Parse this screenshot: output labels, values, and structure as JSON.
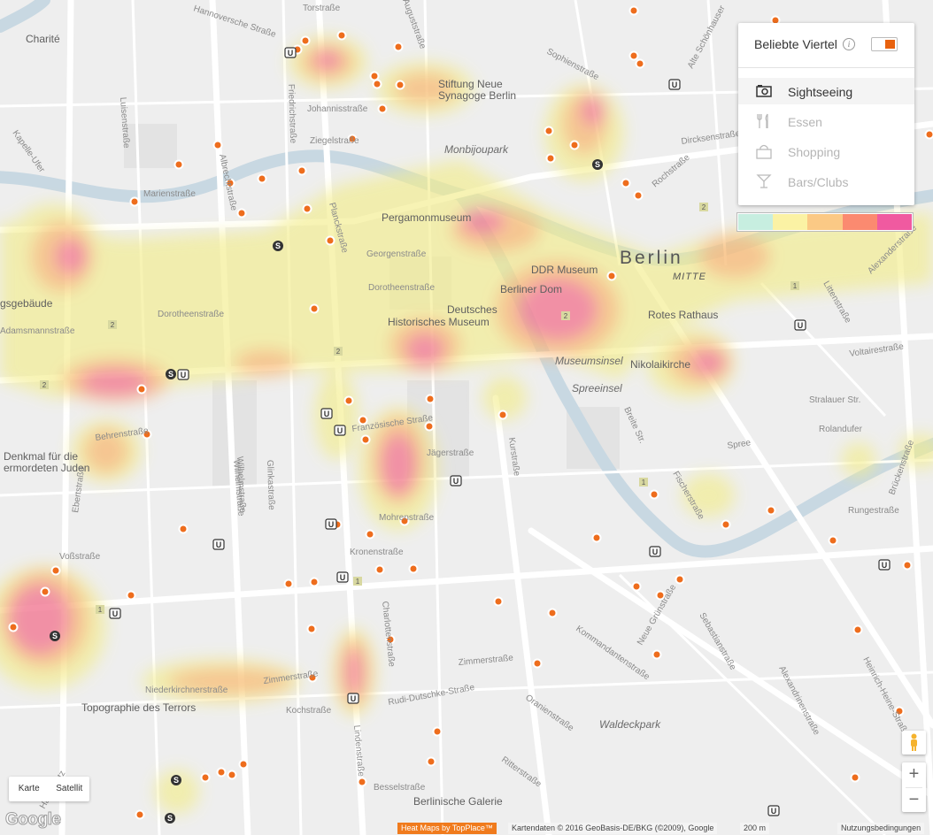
{
  "panel": {
    "title": "Beliebte Viertel",
    "info_glyph": "i",
    "toggle_on": true,
    "categories": [
      {
        "label": "Sightseeing",
        "icon": "camera-icon",
        "active": true
      },
      {
        "label": "Essen",
        "icon": "fork-knife-icon",
        "active": false
      },
      {
        "label": "Shopping",
        "icon": "shopping-bag-icon",
        "active": false
      },
      {
        "label": "Bars/Clubs",
        "icon": "cocktail-icon",
        "active": false
      }
    ]
  },
  "legend_colors": [
    "#c7eee0",
    "#fbf2a4",
    "#fbc985",
    "#fb8a70",
    "#f05aa0"
  ],
  "accent_color": "#e8620e",
  "map_labels": {
    "city": "Berlin",
    "district": "MITTE",
    "pois": [
      "Charité",
      "Pergamonmuseum",
      "DDR Museum",
      "Berliner Dom",
      "Deutsches",
      "Historisches Museum",
      "Rotes Rathaus",
      "Nikolaikirche",
      "Stiftung Neue",
      "Synagoge Berlin",
      "Topographie des Terrors",
      "Berlinische Galerie",
      "Denkmal für die",
      "ermordeten Juden",
      "gsgebäude"
    ],
    "parks": [
      "Monbijoupark",
      "Museumsinsel",
      "Spreeinsel",
      "Waldeckpark"
    ],
    "streets": [
      "Hannoversche Straße",
      "Torstraße",
      "Auguststraße",
      "Sophienstraße",
      "Alte Schönhauser",
      "Johannisstraße",
      "Ziegelstraße",
      "Dircksenstraße",
      "Rochstraße",
      "Marienstraße",
      "Albrechtstraße",
      "Luisenstraße",
      "Friedrichstraße",
      "Planckstraße",
      "Georgenstraße",
      "Dorotheenstraße",
      "Oranienburger Straße",
      "Reinhardtstraße",
      "Gipsstraße",
      "Behrenstraße",
      "Wilhelmstraße",
      "Französische Straße",
      "Jägerstraße",
      "Mohrenstraße",
      "Kronenstraße",
      "Mauerstraße",
      "Glinkastraße",
      "Voßstraße",
      "Ebertstraße",
      "Leipziger Straße",
      "Niederkirchnerstraße",
      "Zimmerstraße",
      "Kochstraße",
      "Rudi-Dutschke-Straße",
      "Lindenstraße",
      "Charlottenstraße",
      "Markgrafenstraße",
      "Besselstraße",
      "Ritterstraße",
      "Oranienstraße",
      "Kommandantenstraße",
      "Neue Grünstraße",
      "Sebastianstraße",
      "Alexandrinenstraße",
      "Heinrich-Heine-Straße",
      "Köpenicker Straße",
      "Brückenstraße",
      "Rungestraße",
      "Fischerstraße",
      "Breite Str.",
      "Kurstraße",
      "Spree",
      "Stralauer Str.",
      "Rolandufer",
      "Littenstraße",
      "Voltairestraße",
      "Alexanderstraße",
      "Kleine Alexanderstraße",
      "Adamsmannstraße",
      "Kapelle-Ufer",
      "Hafenplatz",
      "Stresemannstraße"
    ],
    "route_badges": [
      "2",
      "2",
      "2",
      "2",
      "2",
      "1",
      "1",
      "1",
      "1",
      "1"
    ]
  },
  "map_type": {
    "map": "Karte",
    "satellite": "Satellit"
  },
  "zoom": {
    "in": "+",
    "out": "−"
  },
  "footer": {
    "google": "Google",
    "heatmap_credit": "Heat Maps by TopPlace™",
    "attribution": "Kartendaten © 2016 GeoBasis-DE/BKG (©2009), Google",
    "scale": "200 m",
    "terms": "Nutzungsbedingungen"
  }
}
